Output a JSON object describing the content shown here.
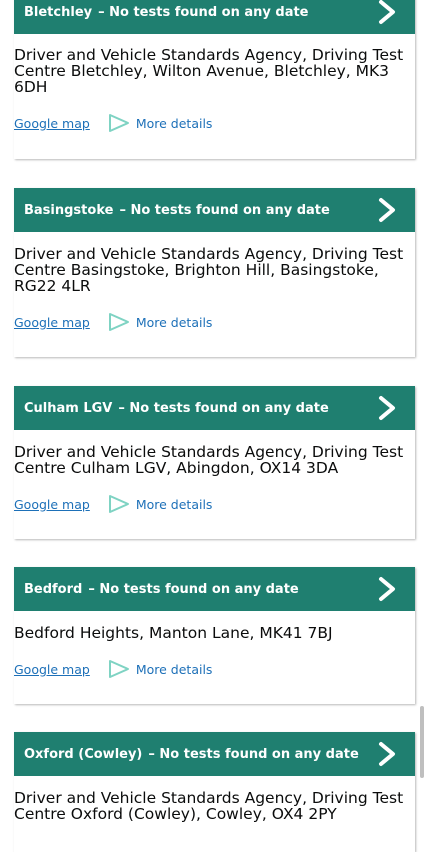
{
  "centres": [
    {
      "name": "Bletchley",
      "status": "– No tests found on any date",
      "address": "Driver and Vehicle Standards Agency, Driving Test Centre Bletchley, Wilton Avenue, Bletchley, MK3 6DH",
      "map_link": "Google map",
      "details_link": "More details"
    },
    {
      "name": "Basingstoke",
      "status": "– No tests found on any date",
      "address": "Driver and Vehicle Standards Agency, Driving Test Centre Basingstoke, Brighton Hill, Basingstoke, RG22 4LR",
      "map_link": "Google map",
      "details_link": "More details"
    },
    {
      "name": "Culham LGV",
      "status": "– No tests found on any date",
      "address": "Driver and Vehicle Standards Agency, Driving Test Centre Culham LGV, Abingdon, OX14 3DA",
      "map_link": "Google map",
      "details_link": "More details"
    },
    {
      "name": "Bedford",
      "status": "– No tests found on any date",
      "address": "Bedford Heights, Manton Lane, MK41 7BJ",
      "map_link": "Google map",
      "details_link": "More details"
    },
    {
      "name": "Oxford (Cowley)",
      "status": "– No tests found on any date",
      "address": "Driver and Vehicle Standards Agency, Driving Test Centre Oxford (Cowley), Cowley, OX4 2PY",
      "map_link": "",
      "details_link": ""
    }
  ],
  "icons": {
    "expand": "chevron-right-icon",
    "details": "play-triangle-icon"
  },
  "colors": {
    "header": "#1f7f70",
    "link": "#1d70b8",
    "triangle": "#7fd3c3"
  }
}
